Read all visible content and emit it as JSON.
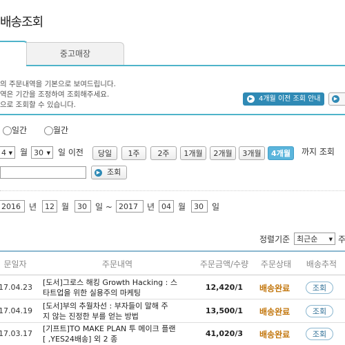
{
  "page": {
    "title": "배송조회"
  },
  "tabs": {
    "used_market": "중고매장"
  },
  "notice": {
    "line1": "의 주문내역을 기본으로 보여드립니다.",
    "line2": "역은 기간을 조정하여 조회해주세요.",
    "line3": "으로 조회할 수 있습니다.",
    "guide_button": "4개월 이전 조회 안내",
    "info_icon": "info-icon"
  },
  "period_type": {
    "daily": "일간",
    "monthly": "월간"
  },
  "relative": {
    "month_value": "4",
    "month_label": "월",
    "day_value": "30",
    "day_label": "일 이전",
    "buttons": [
      "당일",
      "1주",
      "2주",
      "1개월",
      "2개월",
      "3개월",
      "4개월"
    ],
    "selected": "4개월",
    "suffix": "까지 조회"
  },
  "search": {
    "input_value": "",
    "button": "조회"
  },
  "range": {
    "from_year": "2016",
    "year_label": "년",
    "from_month": "12",
    "month_label": "월",
    "from_day": "30",
    "day_sep": "일 ~",
    "to_year": "2017",
    "to_month": "04",
    "to_day": "30",
    "day_label": "일"
  },
  "sort": {
    "label": "정렬기준",
    "value": "최근순",
    "suffix": "주"
  },
  "table": {
    "headers": [
      "문일자",
      "주문내역",
      "주문금액/수량",
      "주문상태",
      "배송추적"
    ],
    "rows": [
      {
        "date": "17.04.23",
        "item_line1": "[도서]그로스 해킹 Growth Hacking : 스",
        "item_line2": "타트업을 위한 실용주의 마케팅",
        "amount": "12,420/1",
        "status": "배송완료",
        "track": "조회"
      },
      {
        "date": "17.04.19",
        "item_line1": "[도서]부의 추월차선 : 부자들이 말해 주",
        "item_line2": "지 않는 진정한 부를 얻는 방법",
        "amount": "13,500/1",
        "status": "배송완료",
        "track": "조회"
      },
      {
        "date": "17.03.17",
        "item_line1": "[기프트]TO MAKE PLAN 투 메이크 플랜",
        "item_line2": "[ ,YES24배송] 외 2 종",
        "amount": "41,020/3",
        "status": "배송완료",
        "track": "조회"
      }
    ]
  },
  "colors": {
    "accent": "#4eb3c9",
    "button_blue": "#2f8ab5",
    "status": "#c2760c",
    "active_period": "#5bb5dc"
  }
}
